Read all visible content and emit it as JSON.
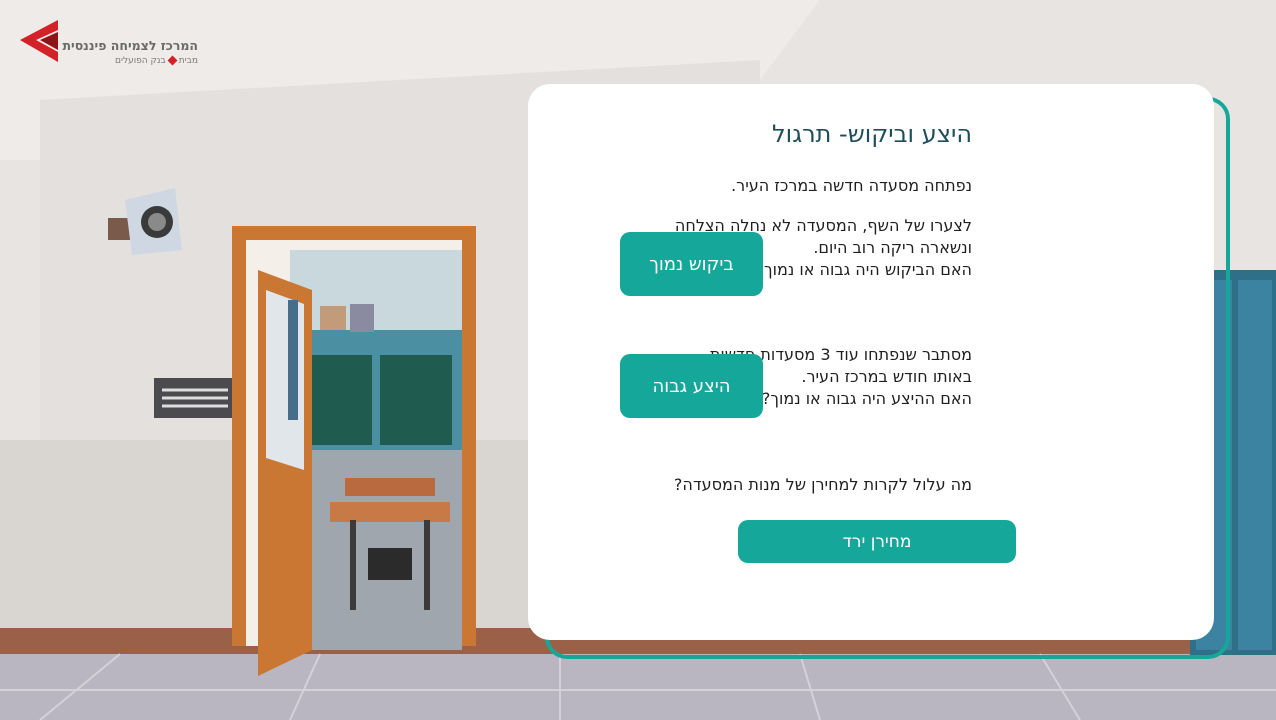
{
  "logo": {
    "title": "המרכז לצמיחה פיננסית",
    "subtitle_left": "מבית",
    "subtitle_right": "בנק הפועלים"
  },
  "card": {
    "title": "היצע וביקוש- תרגול",
    "intro": "נפתחה  מסעדה חדשה במרכז העיר.",
    "q1": [
      "לצערו של השף, המסעדה לא נחלה הצלחה",
      "ונשארה ריקה רוב היום.",
      "האם הביקוש היה גבוה או נמוך?"
    ],
    "q2": [
      "מסתבר שנפתחו עוד 3 מסעדות חדשות",
      "באותו חודש במרכז העיר.",
      "האם ההיצע היה גבוה או נמוך?"
    ],
    "q3": "מה עלול לקרות למחירן של מנות המסעדה?"
  },
  "buttons": {
    "low_demand": "ביקוש נמוך",
    "high_supply": "היצע גבוה",
    "price_down": "מחירן ירד"
  },
  "colors": {
    "accent": "#15a89a",
    "brand_red": "#d42027",
    "title": "#1f4e5a"
  }
}
